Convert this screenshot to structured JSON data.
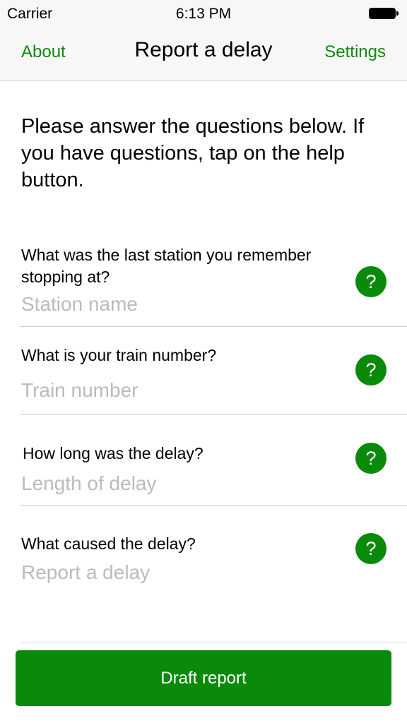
{
  "status_bar": {
    "carrier": "Carrier",
    "time": "6:13 PM",
    "battery_icon": "battery-full-icon"
  },
  "nav": {
    "left": "About",
    "title": "Report a delay",
    "right": "Settings",
    "accent": "#0a8a0a"
  },
  "intro": "Please answer the questions below. If you have questions, tap on the help button.",
  "questions": [
    {
      "label": "What was the last station you remember stopping at?",
      "placeholder": "Station name",
      "help": "?"
    },
    {
      "label": "What is your train number?",
      "placeholder": "Train number",
      "help": "?"
    },
    {
      "label": "How long was the delay?",
      "placeholder": "Length of delay",
      "help": "?"
    },
    {
      "label": "What caused the delay?",
      "placeholder": "Report a delay",
      "help": "?"
    }
  ],
  "button": {
    "label": "Draft report"
  }
}
